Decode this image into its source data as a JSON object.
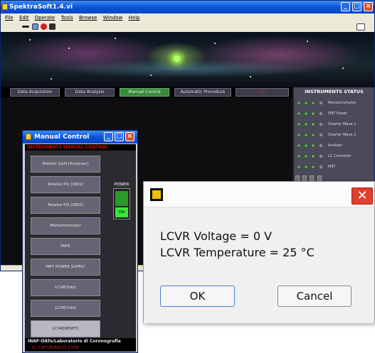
{
  "main_window": {
    "title": "SpektraSoft1.4.vi",
    "menu": [
      "File",
      "Edit",
      "Operate",
      "Tools",
      "Browse",
      "Window",
      "Help"
    ],
    "nav_tabs": [
      "Data Acquisition",
      "Data Analysis",
      "Manual Control",
      "Automatic Procedure",
      "EXIT"
    ],
    "active_tab_color": "#3a8a3a",
    "exit_color": "#c03030"
  },
  "instruments_status": {
    "title": "INSTRUMENTS STATUS",
    "items": [
      "Monochromator",
      "PMT Power",
      "Quarter Wave 1",
      "Quarter Wave 2",
      "Analizer",
      "LC Controller",
      "PMT"
    ]
  },
  "manual_control": {
    "title": "Manual Control",
    "header": "INSTRUMENTS  MANUAL CONTROL",
    "buttons": [
      "Rotator Galil [Analyzer]",
      "Rotator PI1 [QW1]",
      "Rotator PI2 [QW2]",
      "Monochromator",
      "PMTs",
      "PMT POWER SUPPLY",
      "LCVR[Vdd]",
      "LCVR[Vdd]",
      "LCVR[RESET]"
    ],
    "power_label": "POWER",
    "power_state": "ON",
    "footer_line1": "INAF-OATo/Laboratorio di Coronografia",
    "footer_line2": "G. CAPOBIANCO 2008"
  },
  "dialog": {
    "line1": "LCVR Voltage = 0 V",
    "line2": "LCVR Temperature = 25 °C",
    "ok_label": "OK",
    "cancel_label": "Cancel"
  }
}
